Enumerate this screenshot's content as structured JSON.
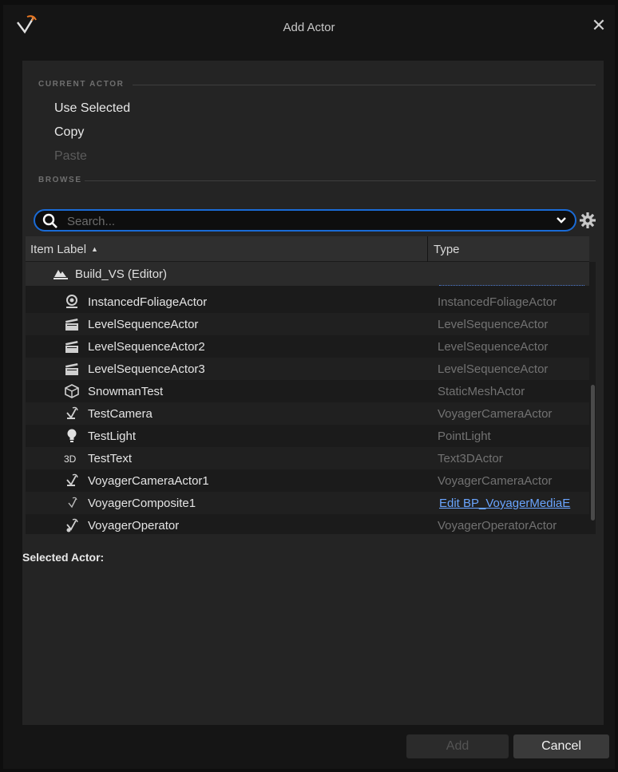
{
  "window": {
    "title": "Add Actor"
  },
  "sections": {
    "current_actor": "CURRENT ACTOR",
    "browse": "BROWSE"
  },
  "current_actor_menu": [
    {
      "label": "Use Selected",
      "enabled": true
    },
    {
      "label": "Copy",
      "enabled": true
    },
    {
      "label": "Paste",
      "enabled": false
    }
  ],
  "search": {
    "placeholder": "Search...",
    "value": ""
  },
  "table": {
    "columns": [
      "Item Label",
      "Type"
    ],
    "sort_column": "Item Label",
    "sort_direction": "ascending",
    "group": {
      "label": "Build_VS (Editor)",
      "icon": "level-icon"
    },
    "rows": [
      {
        "label": "InstancedFoliageActor",
        "type": "InstancedFoliageActor",
        "icon": "foliage-icon"
      },
      {
        "label": "LevelSequenceActor",
        "type": "LevelSequenceActor",
        "icon": "clapperboard-icon"
      },
      {
        "label": "LevelSequenceActor2",
        "type": "LevelSequenceActor",
        "icon": "clapperboard-icon"
      },
      {
        "label": "LevelSequenceActor3",
        "type": "LevelSequenceActor",
        "icon": "clapperboard-icon"
      },
      {
        "label": "SnowmanTest",
        "type": "StaticMeshActor",
        "icon": "static-mesh-icon"
      },
      {
        "label": "TestCamera",
        "type": "VoyagerCameraActor",
        "icon": "voyager-camera-icon"
      },
      {
        "label": "TestLight",
        "type": "PointLight",
        "icon": "light-bulb-icon"
      },
      {
        "label": "TestText",
        "type": "Text3DActor",
        "icon": "text3d-icon"
      },
      {
        "label": "VoyagerCameraActor1",
        "type": "VoyagerCameraActor",
        "icon": "voyager-camera-icon"
      },
      {
        "label": "VoyagerComposite1",
        "type": "Edit BP_VoyagerMediaE",
        "icon": "voyager-composite-icon",
        "link": true
      },
      {
        "label": "VoyagerOperator",
        "type": "VoyagerOperatorActor",
        "icon": "voyager-operator-icon"
      }
    ]
  },
  "selected_actor_label": "Selected Actor:",
  "buttons": {
    "add": "Add",
    "cancel": "Cancel"
  },
  "colors": {
    "accent": "#1a6bd6",
    "link": "#6aa5ff",
    "background": "#151515",
    "panel": "#242424"
  }
}
